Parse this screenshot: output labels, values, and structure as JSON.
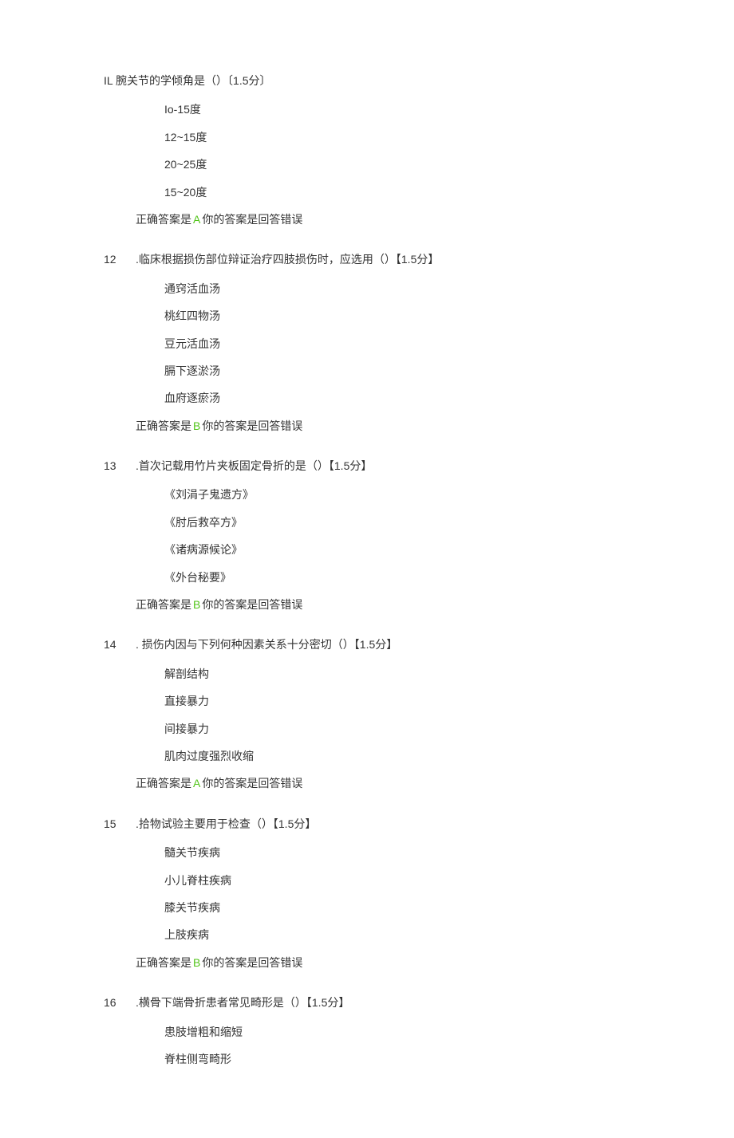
{
  "questions": [
    {
      "num": "IL",
      "text": "腕关节的学倾角是（）〔1.5分〕",
      "options": [
        "Io-15度",
        "12~15度",
        "20~25度",
        "15~20度"
      ],
      "answer_prefix": "正确答案是",
      "answer_letter": "A",
      "answer_suffix": "你的答案是回答错误"
    },
    {
      "num": "12",
      "text": ".临床根据损伤部位辩证治疗四肢损伤时，应选用（）【1.5分】",
      "options": [
        "通窍活血汤",
        "桃红四物汤",
        "豆元活血汤",
        "膈下逐淤汤",
        "血府逐瘀汤"
      ],
      "answer_prefix": "正确答案是",
      "answer_letter": "B",
      "answer_suffix": "你的答案是回答错误"
    },
    {
      "num": "13",
      "text": ".首次记载用竹片夹板固定骨折的是（）【1.5分】",
      "options": [
        "《刘涓子鬼遗方》",
        "《肘后救卒方》",
        "《诸病源候论》",
        "《外台秘要》"
      ],
      "answer_prefix": "正确答案是",
      "answer_letter": "B",
      "answer_suffix": "你的答案是回答错误"
    },
    {
      "num": "14",
      "text": ". 损伤内因与下列何种因素关系十分密切（）【1.5分】",
      "options": [
        "解剖结构",
        "直接暴力",
        "间接暴力",
        "肌肉过度强烈收缩"
      ],
      "answer_prefix": "正确答案是",
      "answer_letter": "A",
      "answer_suffix": "你的答案是回答错误"
    },
    {
      "num": "15",
      "text": ".拾物试验主要用于检查（）【1.5分】",
      "options": [
        "髓关节疾病",
        "小儿脊柱疾病",
        "膝关节疾病",
        "上肢疾病"
      ],
      "answer_prefix": "正确答案是",
      "answer_letter": "B",
      "answer_suffix": "你的答案是回答错误"
    },
    {
      "num": "16",
      "text": ".横骨下端骨折患者常见畸形是（）【1.5分】",
      "options": [
        "患肢增粗和缩短",
        "脊柱侧弯畸形"
      ],
      "answer_prefix": "",
      "answer_letter": "",
      "answer_suffix": ""
    }
  ]
}
